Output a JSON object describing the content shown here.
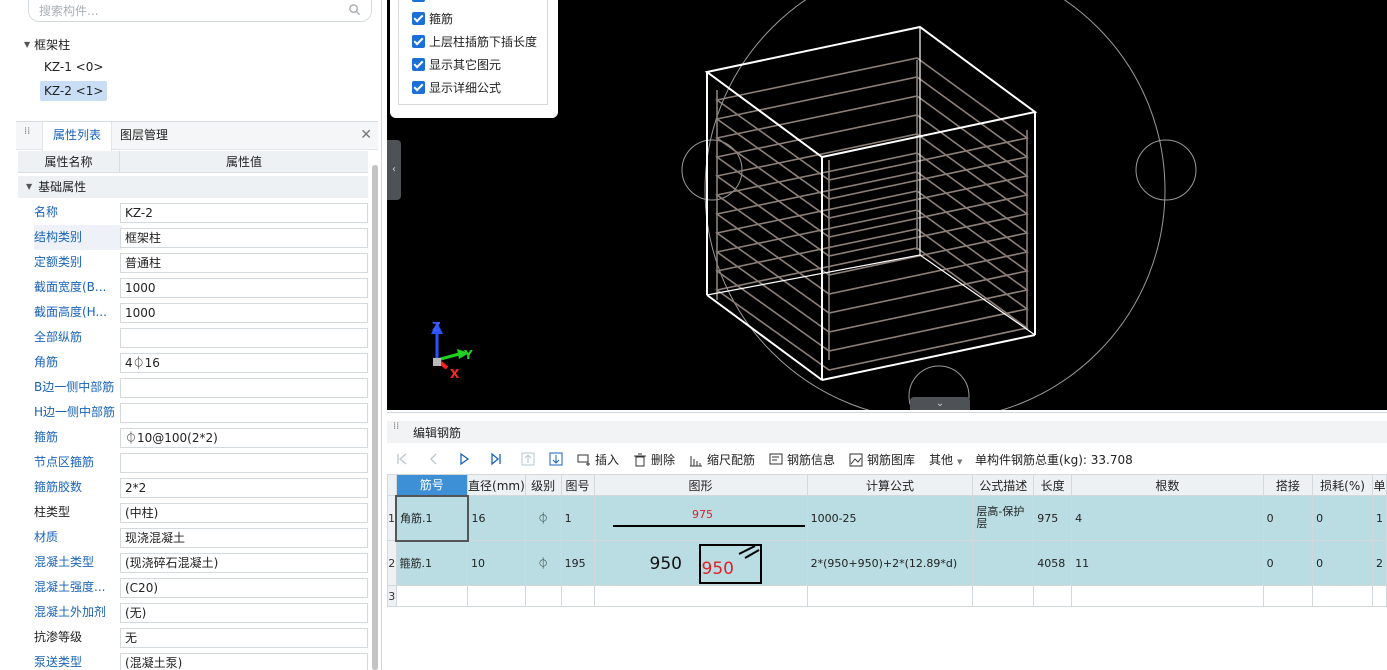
{
  "search": {
    "placeholder": "搜索构件..."
  },
  "tree": {
    "root": "框架柱",
    "items": [
      "KZ-1 <0>",
      "KZ-2 <1>"
    ]
  },
  "prop_tabs": [
    "属性列表",
    "图层管理"
  ],
  "prop_header": {
    "name_col": "属性名称",
    "value_col": "属性值"
  },
  "prop_group": "基础属性",
  "props": [
    {
      "name": "名称",
      "value": "KZ-2"
    },
    {
      "name": "结构类别",
      "value": "框架柱"
    },
    {
      "name": "定额类别",
      "value": "普通柱"
    },
    {
      "name": "截面宽度(B...",
      "value": "1000"
    },
    {
      "name": "截面高度(H...",
      "value": "1000"
    },
    {
      "name": "全部纵筋",
      "value": ""
    },
    {
      "name": "角筋",
      "value": "4⏀16"
    },
    {
      "name": "B边一侧中部筋",
      "value": ""
    },
    {
      "name": "H边一侧中部筋",
      "value": ""
    },
    {
      "name": "箍筋",
      "value": "⏀10@100(2*2)"
    },
    {
      "name": "节点区箍筋",
      "value": ""
    },
    {
      "name": "箍筋胶数",
      "value": "2*2"
    },
    {
      "name": "柱类型",
      "value": "(中柱)"
    },
    {
      "name": "材质",
      "value": "现浇混凝土"
    },
    {
      "name": "混凝土类型",
      "value": "(现浇碎石混凝土)"
    },
    {
      "name": "混凝土强度...",
      "value": "(C20)"
    },
    {
      "name": "混凝土外加剂",
      "value": "(无)"
    },
    {
      "name": "抗渗等级",
      "value": "无"
    },
    {
      "name": "泵送类型",
      "value": "(混凝土泵)"
    }
  ],
  "options": [
    "箍筋",
    "上层柱插筋下插长度",
    "显示其它图元",
    "显示详细公式"
  ],
  "axes": {
    "z": "Z",
    "y": "Y",
    "x": "X"
  },
  "editor": {
    "title": "编辑钢筋",
    "toolbar": {
      "insert": "插入",
      "delete": "删除",
      "scale_rebar": "缩尺配筋",
      "rebar_info": "钢筋信息",
      "rebar_lib": "钢筋图库",
      "other": "其他",
      "total_weight": "单构件钢筋总重(kg): 33.708"
    },
    "columns": [
      "筋号",
      "直径(mm)",
      "级别",
      "图号",
      "图形",
      "计算公式",
      "公式描述",
      "长度",
      "根数",
      "搭接",
      "损耗(%)",
      "单"
    ],
    "rows": [
      {
        "no": "1",
        "name": "角筋.1",
        "dia": "16",
        "grade": "⏀",
        "fig": "1",
        "shape_val": "975",
        "formula": "1000-25",
        "desc": "层高-保护层",
        "len": "975",
        "count": "4",
        "lap": "0",
        "loss": "0",
        "tail": "1"
      },
      {
        "no": "2",
        "name": "箍筋.1",
        "dia": "10",
        "grade": "⏀",
        "fig": "195",
        "shape_left": "950",
        "shape_val": "950",
        "formula": "2*(950+950)+2*(12.89*d)",
        "desc": "",
        "len": "4058",
        "count": "11",
        "lap": "0",
        "loss": "0",
        "tail": "2"
      },
      {
        "no": "3"
      }
    ]
  }
}
